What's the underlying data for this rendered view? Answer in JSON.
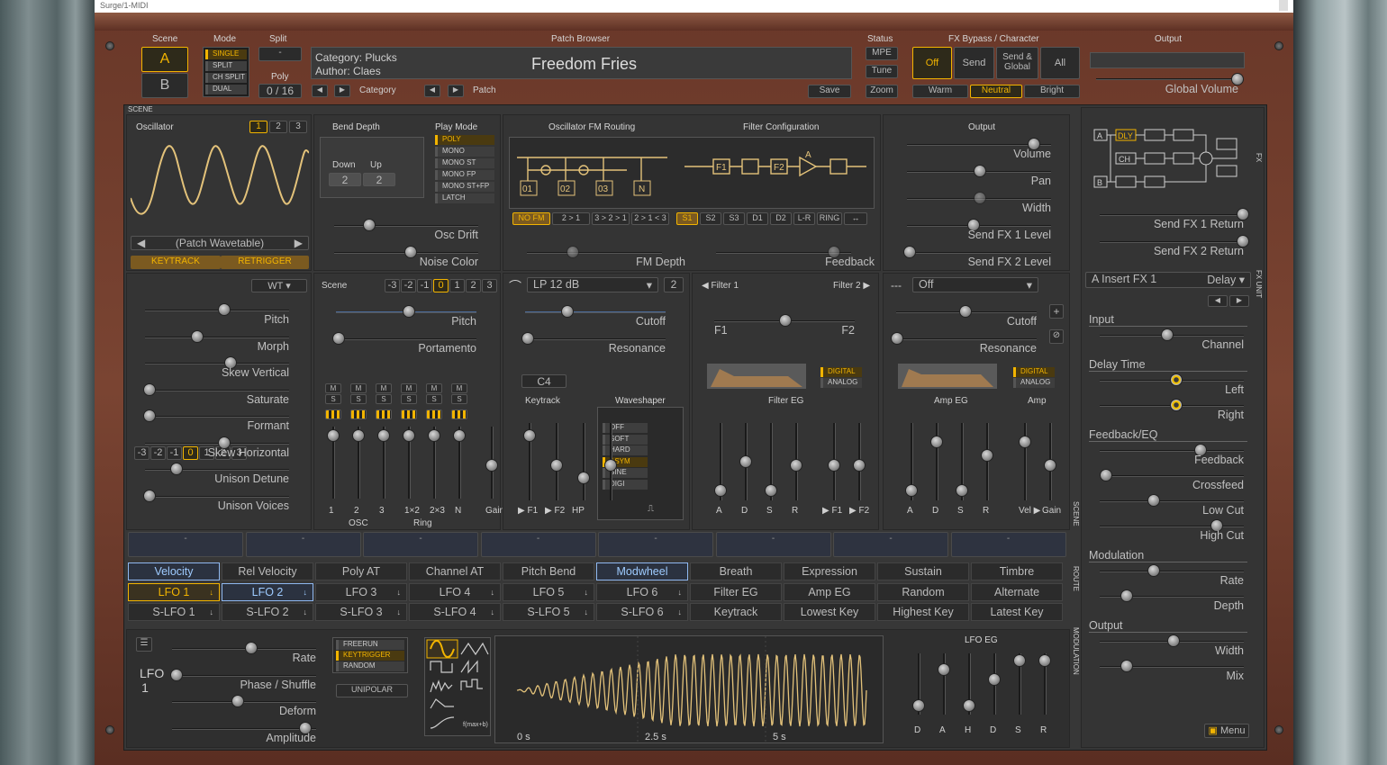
{
  "window": {
    "title": "Surge/1-MIDI"
  },
  "top": {
    "scene_label": "Scene",
    "scene_a": "A",
    "scene_b": "B",
    "mode_label": "Mode",
    "modes": [
      "SINGLE",
      "SPLIT",
      "CH SPLIT",
      "DUAL"
    ],
    "split_label": "Split",
    "split_value": "-",
    "poly_label": "Poly",
    "poly_value": "0 / 16",
    "browser_label": "Patch Browser",
    "category": "Category: Plucks",
    "author": "Author: Claes",
    "patch_name": "Freedom Fries",
    "category_btn": "Category",
    "patch_btn": "Patch",
    "save": "Save",
    "status_label": "Status",
    "status": [
      "MPE",
      "Tune",
      "Zoom"
    ],
    "fx_label": "FX Bypass / Character",
    "fx_bypass": [
      "Off",
      "Send",
      "Send & Global",
      "All"
    ],
    "character": [
      "Warm",
      "Neutral",
      "Bright"
    ],
    "output_label": "Output",
    "global_volume": "Global Volume",
    "scene_tag": "SCENE"
  },
  "osc": {
    "label": "Oscillator",
    "tabs": [
      "1",
      "2",
      "3"
    ],
    "wavetable": "(Patch Wavetable)",
    "keytrack": "KEYTRACK",
    "retrigger": "RETRIGGER",
    "octave": [
      "-3",
      "-2",
      "-1",
      "0",
      "1",
      "2",
      "3"
    ],
    "type": "WT",
    "params": [
      "Pitch",
      "Morph",
      "Skew Vertical",
      "Saturate",
      "Formant",
      "Skew Horizontal",
      "Unison Detune",
      "Unison Voices"
    ]
  },
  "bend": {
    "label": "Bend Depth",
    "down_label": "Down",
    "up_label": "Up",
    "down": "2",
    "up": "2",
    "osc_drift": "Osc Drift",
    "noise_color": "Noise Color"
  },
  "play": {
    "label": "Play Mode",
    "modes": [
      "POLY",
      "MONO",
      "MONO ST",
      "MONO FP",
      "MONO ST+FP",
      "LATCH"
    ]
  },
  "scene_osc": {
    "label": "Scene",
    "octave": [
      "-3",
      "-2",
      "-1",
      "0",
      "1",
      "2",
      "3"
    ],
    "pitch": "Pitch",
    "portamento": "Portamento",
    "mixer_labels": [
      "1",
      "2",
      "3",
      "1×2",
      "2×3",
      "N",
      "Gain"
    ],
    "osc_group": "OSC",
    "ring_group": "Ring",
    "m": "M",
    "s": "S"
  },
  "fm": {
    "label": "Oscillator FM Routing",
    "routes": [
      "NO FM",
      "2 > 1",
      "3 > 2 > 1",
      "2 > 1 < 3"
    ],
    "fm_depth": "FM Depth",
    "nodes": [
      "01",
      "02",
      "03",
      "N"
    ]
  },
  "filter_cfg": {
    "label": "Filter Configuration",
    "routes": [
      "S1",
      "S2",
      "S3",
      "D1",
      "D2",
      "L-R",
      "RING",
      "↔"
    ],
    "feedback": "Feedback",
    "nodes": [
      "F1",
      "F2",
      "A"
    ]
  },
  "output": {
    "label": "Output",
    "params": [
      "Volume",
      "Pan",
      "Width",
      "Send FX 1 Level",
      "Send FX 2 Level"
    ]
  },
  "fx_right": {
    "send1_return": "Send FX 1 Return",
    "send2_return": "Send FX 2 Return",
    "insert": "A Insert FX 1",
    "insert_type": "Delay",
    "groups": [
      {
        "name": "Input",
        "params": [
          "Channel"
        ]
      },
      {
        "name": "Delay Time",
        "params": [
          "Left",
          "Right"
        ]
      },
      {
        "name": "Feedback/EQ",
        "params": [
          "Feedback",
          "Crossfeed",
          "Low Cut",
          "High Cut"
        ]
      },
      {
        "name": "Modulation",
        "params": [
          "Rate",
          "Depth"
        ]
      },
      {
        "name": "Output",
        "params": [
          "Width",
          "Mix"
        ]
      }
    ],
    "menu": "Menu",
    "fx_tag": "FX",
    "fx_unit_tag": "FX UNIT",
    "fx_nodes": [
      "A",
      "DLY",
      "CH",
      "B"
    ]
  },
  "filter1": {
    "type": "LP 12 dB",
    "sub": "2",
    "cutoff": "Cutoff",
    "resonance": "Resonance",
    "keytrack": "Keytrack",
    "key": "C4",
    "waveshaper": "Waveshaper",
    "ws_modes": [
      "OFF",
      "SOFT",
      "HARD",
      "ASYM",
      "SINE",
      "DIGI"
    ],
    "f1": "▶ F1",
    "f2": "▶ F2",
    "hp": "HP"
  },
  "filter_mid": {
    "f1_label": "◀ Filter 1",
    "f2_label": "Filter 2 ▶",
    "f1": "F1",
    "f2": "F2",
    "filter_eg": "Filter EG",
    "digital": "DIGITAL",
    "analog": "ANALOG",
    "adsr": [
      "A",
      "D",
      "S",
      "R"
    ],
    "f1b": "▶ F1",
    "f2b": "▶ F2"
  },
  "filter2": {
    "dash": "---",
    "type": "Off",
    "cutoff": "Cutoff",
    "resonance": "Resonance",
    "amp_eg": "Amp EG",
    "amp": "Amp",
    "digital": "DIGITAL",
    "analog": "ANALOG",
    "adsr": [
      "A",
      "D",
      "S",
      "R"
    ],
    "vel": "Vel ▶",
    "gain": "Gain"
  },
  "macros": [
    "-",
    "-",
    "-",
    "-",
    "-",
    "-",
    "-",
    "-"
  ],
  "mod_rows": [
    [
      "Velocity",
      "Rel Velocity",
      "Poly AT",
      "Channel AT",
      "Pitch Bend",
      "Modwheel",
      "Breath",
      "Expression",
      "Sustain",
      "Timbre"
    ],
    [
      "LFO 1",
      "LFO 2",
      "LFO 3",
      "LFO 4",
      "LFO 5",
      "LFO 6",
      "Filter EG",
      "Amp EG",
      "Random",
      "Alternate"
    ],
    [
      "S-LFO 1",
      "S-LFO 2",
      "S-LFO 3",
      "S-LFO 4",
      "S-LFO 5",
      "S-LFO 6",
      "Keytrack",
      "Lowest Key",
      "Highest Key",
      "Latest Key"
    ]
  ],
  "tags": {
    "scene": "SCENE",
    "route": "ROUTE",
    "modulation": "MODULATION"
  },
  "lfo": {
    "name": "LFO 1",
    "params": [
      "Rate",
      "Phase / Shuffle",
      "Deform",
      "Amplitude"
    ],
    "trig": [
      "FREERUN",
      "KEYTRIGGER",
      "RANDOM"
    ],
    "unipolar": "UNIPOLAR",
    "times": [
      "0 s",
      "2.5 s",
      "5 s"
    ],
    "eg_label": "LFO EG",
    "eg": [
      "D",
      "A",
      "H",
      "D",
      "S",
      "R"
    ],
    "formula": "f(max+b)"
  },
  "colors": {
    "accent": "#f2b400",
    "wood": "#6a3829",
    "panel": "#3a3a3a",
    "select": "#8fb8f0"
  }
}
